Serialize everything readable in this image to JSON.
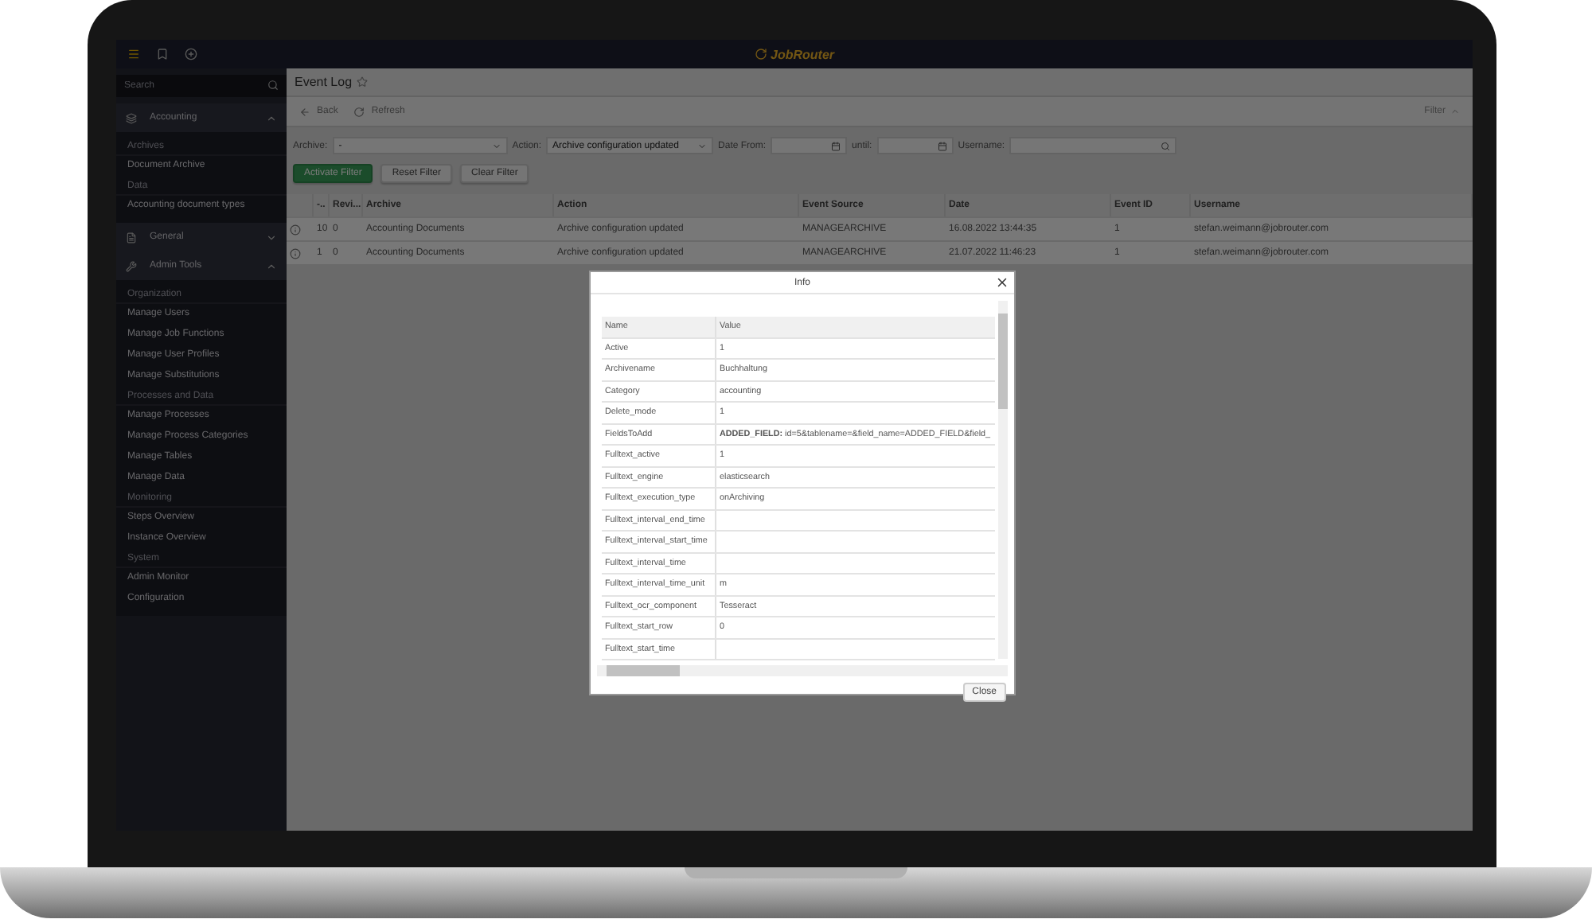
{
  "app": {
    "logo": "JobRouter"
  },
  "sidebar": {
    "search": {
      "placeholder": "Search"
    },
    "groups": [
      {
        "label": "Accounting",
        "expanded": true,
        "sections": [
          {
            "title": "Archives",
            "items": [
              "Document Archive"
            ]
          },
          {
            "title": "Data",
            "items": [
              "Accounting document types"
            ]
          }
        ]
      },
      {
        "label": "General",
        "expanded": false
      },
      {
        "label": "Admin Tools",
        "expanded": true,
        "sections": [
          {
            "title": "Organization",
            "items": [
              "Manage Users",
              "Manage Job Functions",
              "Manage User Profiles",
              "Manage Substitutions"
            ]
          },
          {
            "title": "Processes and Data",
            "items": [
              "Manage Processes",
              "Manage Process Categories",
              "Manage Tables",
              "Manage Data"
            ]
          },
          {
            "title": "Monitoring",
            "items": [
              "Steps Overview",
              "Instance Overview"
            ]
          },
          {
            "title": "System",
            "items": [
              "Admin Monitor",
              "Configuration"
            ]
          }
        ]
      }
    ]
  },
  "page": {
    "title": "Event Log",
    "toolbar": {
      "back": "Back",
      "refresh": "Refresh",
      "filter": "Filter",
      "filter_expanded": true
    },
    "filters": [
      {
        "kind": "select",
        "label": "Archive:",
        "value": "-"
      },
      {
        "kind": "select",
        "label": "Action:",
        "value": "Archive configuration updated"
      },
      {
        "kind": "date",
        "label": "Date From:"
      },
      {
        "kind": "date",
        "label": "until:"
      },
      {
        "kind": "search",
        "label": "Username:"
      }
    ],
    "buttons": [
      {
        "label": "Activate Filter",
        "primary": true
      },
      {
        "label": "Reset Filter",
        "primary": false
      },
      {
        "label": "Clear Filter",
        "primary": false
      }
    ],
    "table": {
      "columns": [
        "-..",
        "Revi...",
        "Archive",
        "Action",
        "Event Source",
        "Date",
        "Event ID",
        "Username"
      ],
      "rows": [
        [
          "10",
          "0",
          "Accounting Documents",
          "Archive configuration updated",
          "MANAGEARCHIVE",
          "16.08.2022 13:44:35",
          "1",
          "stefan.weimann@jobrouter.com"
        ],
        [
          "1",
          "0",
          "Accounting Documents",
          "Archive configuration updated",
          "MANAGEARCHIVE",
          "21.07.2022 11:46:23",
          "1",
          "stefan.weimann@jobrouter.com"
        ]
      ]
    }
  },
  "dialog": {
    "title": "Info",
    "columns": [
      "Name",
      "Value"
    ],
    "rows": [
      {
        "name": "Active",
        "value": "1"
      },
      {
        "name": "Archivename",
        "value": "Buchhaltung"
      },
      {
        "name": "Category",
        "value": "accounting"
      },
      {
        "name": "Delete_mode",
        "value": "1"
      },
      {
        "name": "FieldsToAdd",
        "value": "**ADDED_FIELD:** id=5&tablename=&field_name=ADDED_FIELD&field_"
      },
      {
        "name": "Fulltext_active",
        "value": "1"
      },
      {
        "name": "Fulltext_engine",
        "value": "elasticsearch"
      },
      {
        "name": "Fulltext_execution_type",
        "value": "onArchiving"
      },
      {
        "name": "Fulltext_interval_end_time"
      },
      {
        "name": "Fulltext_interval_start_time"
      },
      {
        "name": "Fulltext_interval_time"
      },
      {
        "name": "Fulltext_interval_time_unit",
        "value": "m"
      },
      {
        "name": "Fulltext_ocr_component",
        "value": "Tesseract"
      },
      {
        "name": "Fulltext_start_row",
        "value": "0"
      },
      {
        "name": "Fulltext_start_time"
      }
    ],
    "close": "Close"
  }
}
